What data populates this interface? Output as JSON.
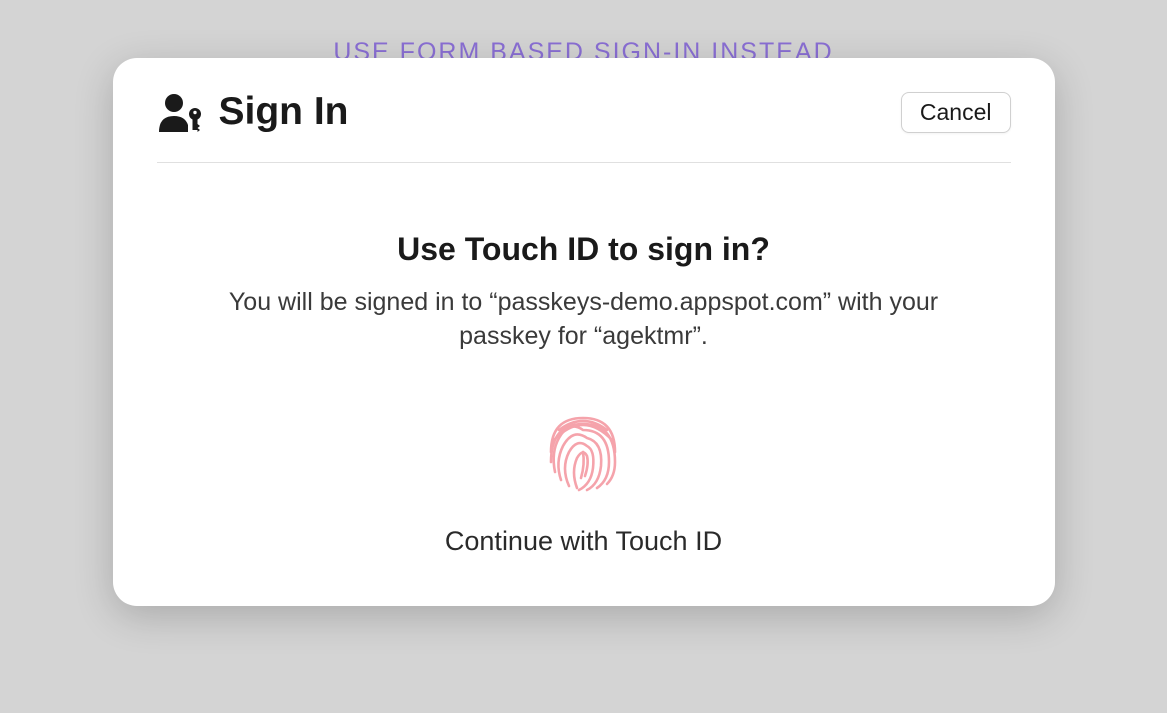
{
  "background": {
    "link_text": "USE FORM BASED SIGN-IN INSTEAD"
  },
  "dialog": {
    "title": "Sign In",
    "cancel_label": "Cancel",
    "prompt_title": "Use Touch ID to sign in?",
    "prompt_description": "You will be signed in to “passkeys-demo.appspot.com” with your passkey for “agektmr”.",
    "continue_label": "Continue with Touch ID"
  },
  "colors": {
    "link": "#8a6fd4",
    "fingerprint": "#f5a3ab"
  }
}
